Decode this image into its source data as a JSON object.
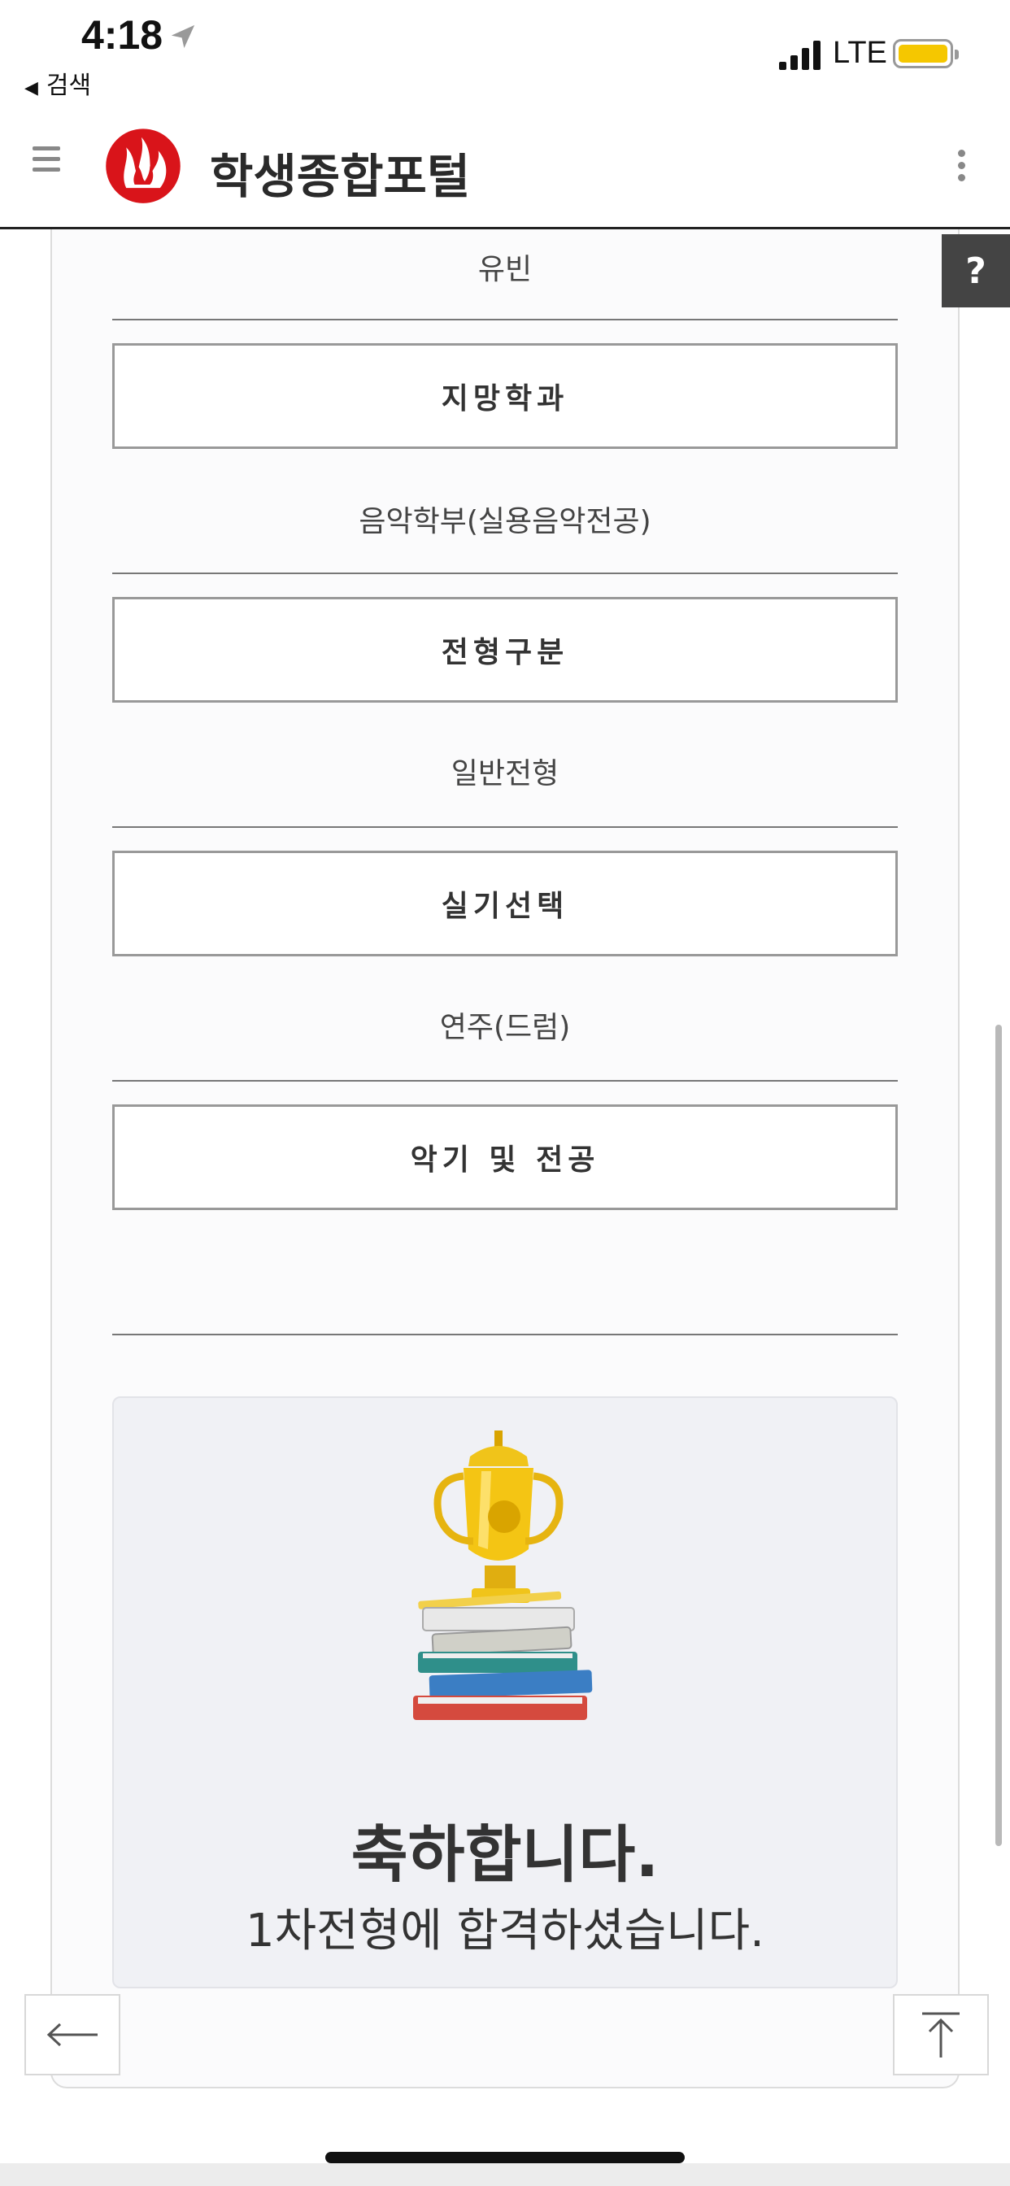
{
  "status_bar": {
    "time": "4:18",
    "back_label": "검색",
    "network": "LTE",
    "battery_color": "#f5c700"
  },
  "header": {
    "title": "학생종합포털",
    "logo_color": "#d9141a"
  },
  "help_label": "?",
  "fields": {
    "name_value": "유빈",
    "department_label": "지망학과",
    "department_value": "음악학부(실용음악전공)",
    "admission_type_label": "전형구분",
    "admission_type_value": "일반전형",
    "practical_label": "실기선택",
    "practical_value": "연주(드럼)",
    "instrument_label": "악기 및 전공",
    "instrument_value": ""
  },
  "result": {
    "title": "축하합니다.",
    "message": "1차전형에 합격하셨습니다."
  },
  "icons": {
    "back": "arrow-left-icon",
    "top": "arrow-up-to-top-icon",
    "menu": "hamburger-menu-icon",
    "more": "more-vertical-icon"
  }
}
